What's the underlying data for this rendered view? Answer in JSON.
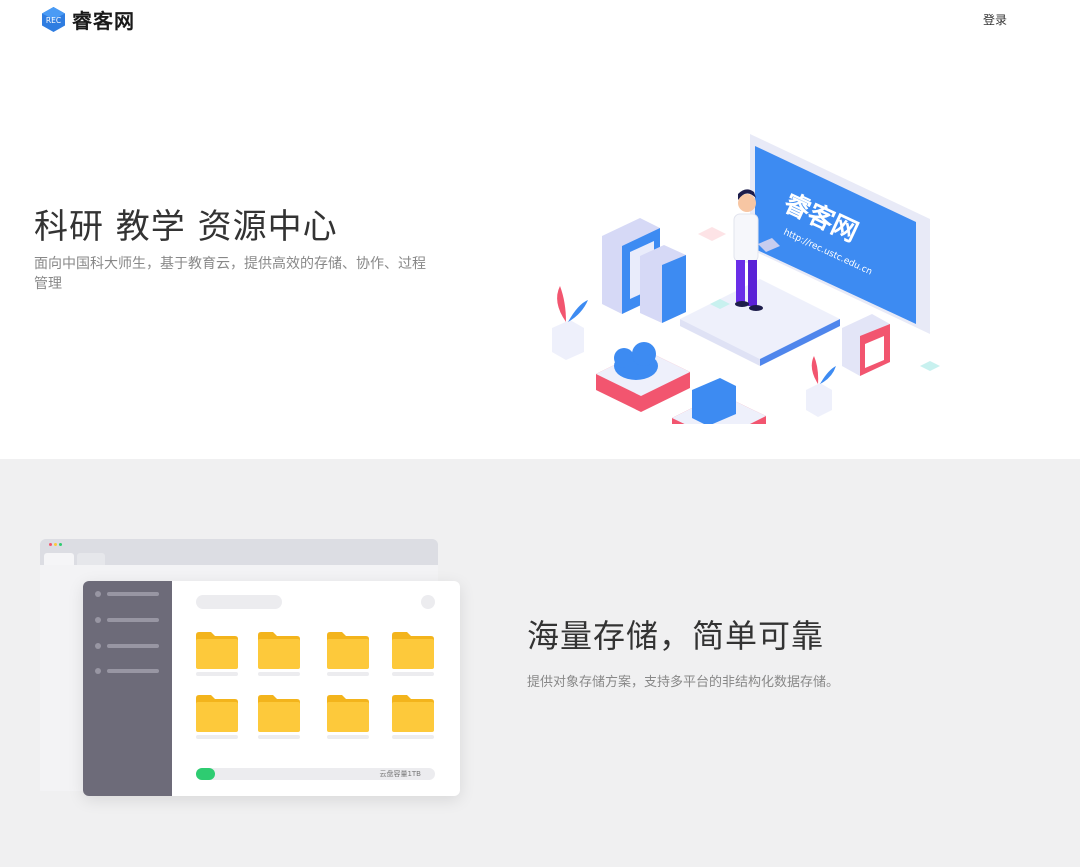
{
  "header": {
    "logo_badge": "REC",
    "site_name": "睿客网",
    "login_label": "登录"
  },
  "hero": {
    "title": "科研 教学 资源中心",
    "description": "面向中国科大师生，基于教育云，提供高效的存储、协作、过程管理",
    "billboard_title": "睿客网",
    "billboard_url": "http://rec.ustc.edu.cn"
  },
  "feature": {
    "title": "海量存储，简单可靠",
    "description": "提供对象存储方案，支持多平台的非结构化数据存储。",
    "storage_label": "云盘容量1TB",
    "storage_used_fraction": 0.08
  },
  "colors": {
    "brand_blue": "#3d8bf2",
    "folder_yellow": "#fdc93b",
    "progress_green": "#2ecc71",
    "accent_pink": "#f2556f"
  }
}
